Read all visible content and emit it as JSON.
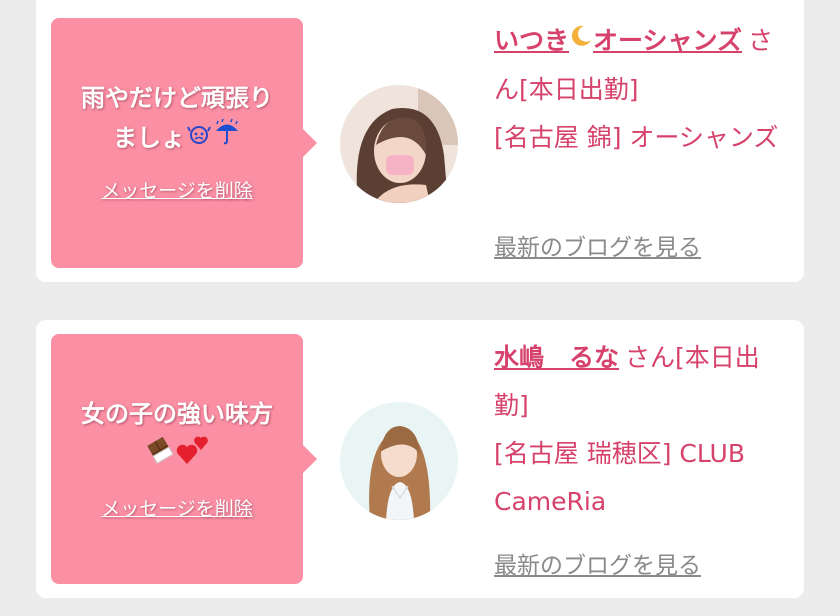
{
  "colors": {
    "bubble_bg": "#fb8fa4",
    "accent_text": "#d6426b",
    "muted_link": "#8a8a8a",
    "page_bg": "#ececec"
  },
  "cards": [
    {
      "message_line1": "雨やだけど頑張り",
      "message_line2": "ましょ",
      "message_emojis": [
        "sweat-drops-emoji",
        "umbrella-rain-emoji"
      ],
      "delete_label": "メッセージを削除",
      "avatar_icon": "profile-photo",
      "name_part1": "いつき",
      "name_moon": "crescent-moon-emoji",
      "name_part2": "オーシャンズ",
      "honorific": "さん",
      "status": "[本日出勤]",
      "location": "[名古屋 錦] オーシャンズ",
      "blog_link": "最新のブログを見る"
    },
    {
      "message_line1": "女の子の強い味方",
      "message_emojis": [
        "chocolate-bar-emoji",
        "two-hearts-emoji"
      ],
      "delete_label": "メッセージを削除",
      "avatar_icon": "profile-photo",
      "name": "水嶋　るな",
      "honorific": "さん",
      "status": "[本日出勤]",
      "location": "[名古屋 瑞穂区] CLUB CameRia",
      "blog_link": "最新のブログを見る"
    }
  ]
}
